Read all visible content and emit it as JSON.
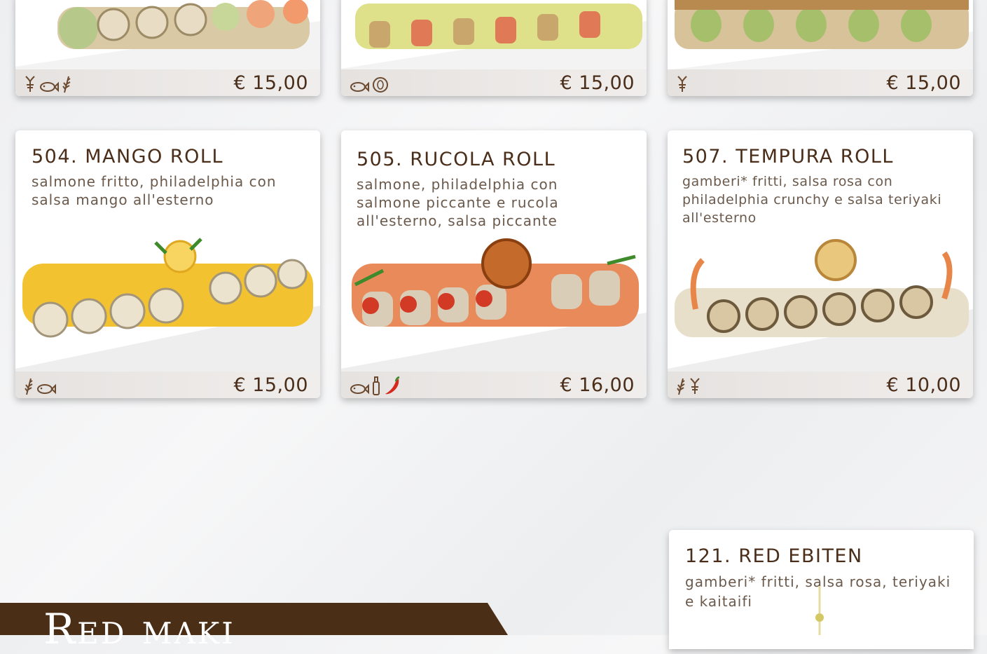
{
  "top_row": [
    {
      "price": "€ 15,00",
      "icons": [
        "shrimp-icon",
        "fish-icon",
        "wheat-icon"
      ]
    },
    {
      "price": "€ 15,00",
      "icons": [
        "fish-icon",
        "sesame-icon"
      ]
    },
    {
      "price": "€ 15,00",
      "icons": [
        "shrimp-icon"
      ]
    }
  ],
  "cards": [
    {
      "title": "504. MANGO ROLL",
      "desc": "salmone fritto, philadelphia con salsa mango all'esterno",
      "price": "€ 15,00",
      "icons": [
        "wheat-icon",
        "fish-icon"
      ]
    },
    {
      "title": "505. RUCOLA ROLL",
      "desc": "salmone, philadelphia con salmone piccante e rucola all'esterno, salsa piccante",
      "price": "€ 16,00",
      "icons": [
        "fish-icon",
        "sauce-bottle-icon",
        "chili-icon"
      ]
    },
    {
      "title": "507. TEMPURA ROLL",
      "desc": "gamberi* fritti, salsa rosa con philadelphia crunchy e salsa teriyaki all'esterno",
      "price": "€ 10,00",
      "icons": [
        "wheat-icon",
        "shrimp-icon"
      ]
    },
    {
      "title": "121. RED EBITEN",
      "desc": "gamberi* fritti, salsa rosa, teriyaki e kaitaifi"
    }
  ],
  "section": {
    "title": "Red maki"
  },
  "colors": {
    "brown": "#4b2e16",
    "chili": "#d6281c",
    "icon": "#6b4a30"
  }
}
